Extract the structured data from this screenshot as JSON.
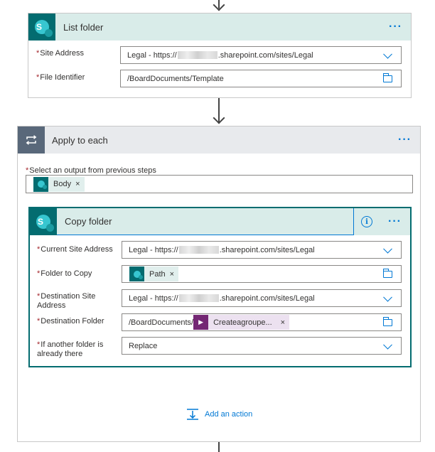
{
  "list_folder": {
    "title": "List folder",
    "more_label": "···",
    "fields": [
      {
        "label": "Site Address",
        "value_prefix": "Legal - https://",
        "value_suffix": ".sharepoint.com/sites/Legal"
      },
      {
        "label": "File Identifier",
        "value": "/BoardDocuments/Template"
      }
    ]
  },
  "apply_to_each": {
    "title": "Apply to each",
    "more_label": "···",
    "select_label": "Select an output from previous steps",
    "token": "Body",
    "token_remove": "×"
  },
  "copy_folder": {
    "title": "Copy folder",
    "info_label": "i",
    "more_label": "···",
    "fields": {
      "current_site": {
        "label": "Current Site Address",
        "value_prefix": "Legal - https://",
        "value_suffix": ".sharepoint.com/sites/Legal"
      },
      "folder_to_copy": {
        "label": "Folder to Copy",
        "token": "Path",
        "token_remove": "×"
      },
      "destination_site": {
        "label": "Destination Site Address",
        "value_prefix": "Legal - https://",
        "value_suffix": ".sharepoint.com/sites/Legal"
      },
      "destination_folder": {
        "label": "Destination Folder",
        "value_prefix": "/BoardDocuments/",
        "token": "Createagroupe...",
        "token_remove": "×"
      },
      "if_exists": {
        "label": "If another folder is already there",
        "value": "Replace"
      }
    }
  },
  "add_action": {
    "label": "Add an action"
  },
  "required_mark": "*",
  "colors": {
    "accent": "#0078d4",
    "sharepoint": "#036c70",
    "sp_header": "#d9ece9",
    "loop_header": "#e8eaed",
    "power_automate": "#742774"
  }
}
